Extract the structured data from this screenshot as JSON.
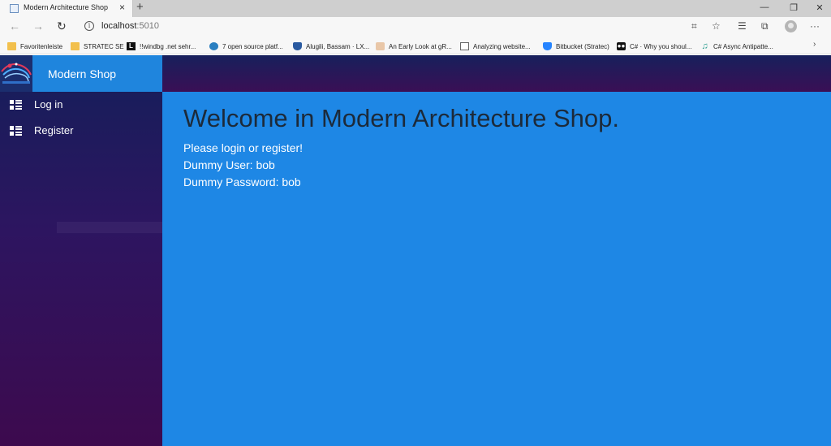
{
  "browser": {
    "tab_title": "Modern Architecture Shop",
    "tab_close": "×",
    "new_tab": "+",
    "window_controls": {
      "minimize": "—",
      "maximize": "❐",
      "close": "✕"
    },
    "nav": {
      "back": "←",
      "forward": "→",
      "reload": "↻",
      "info": "i"
    },
    "url_host": "localhost",
    "url_port": ":5010",
    "toolbar_icons": {
      "read_aloud": "read-aloud-icon",
      "favorite": "star-icon",
      "favorites_list": "favorites-list-icon",
      "collections": "collections-icon",
      "profile": "profile-icon",
      "menu": "more-menu-icon"
    },
    "toolbar_glyphs": {
      "read_aloud": "⌗",
      "favorite": "☆",
      "favorites_list": "☰",
      "collections": "⧉",
      "menu": "···"
    },
    "bookmarks": [
      {
        "label": "Favoritenleiste",
        "icon": "folder-icon"
      },
      {
        "label": "STRATEC SE",
        "icon": "folder-icon"
      },
      {
        "label": "!!windbg .net sehr...",
        "icon": "l-logo-icon"
      },
      {
        "label": "7 open source platf...",
        "icon": "globe-icon"
      },
      {
        "label": "Alugili, Bassam · LX...",
        "icon": "shield-icon"
      },
      {
        "label": "An Early Look at gR...",
        "icon": "avatar-icon"
      },
      {
        "label": "Analyzing website...",
        "icon": "page-icon"
      },
      {
        "label": "Bitbucket (Stratec)",
        "icon": "bitbucket-icon"
      },
      {
        "label": "C# · Why you shoul...",
        "icon": "record-icon"
      },
      {
        "label": "C# Async Antipatte...",
        "icon": "music-note-icon"
      }
    ],
    "bookmark_glyphs": {
      "l": "L",
      "rec": "●●",
      "note": "♫"
    },
    "bookmarks_more": "›"
  },
  "app": {
    "brand": "Modern Shop",
    "nav_items": [
      {
        "label": "Log in",
        "icon": "list-icon"
      },
      {
        "label": "Register",
        "icon": "list-icon"
      }
    ],
    "main": {
      "heading": "Welcome in Modern Architecture Shop.",
      "lines": [
        "Please login or register!",
        "Dummy User: bob",
        "Dummy Password: bob"
      ]
    },
    "colors": {
      "sidebar_top": "#141f5a",
      "sidebar_bottom": "#3d0a4e",
      "brand_bg": "#1f85dd",
      "main_bg": "#1e87e5",
      "heading_text": "#1c2a3a"
    }
  }
}
